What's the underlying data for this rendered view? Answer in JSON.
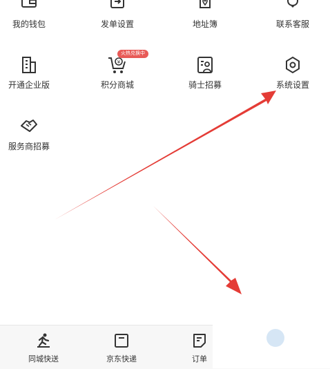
{
  "menu": {
    "items": [
      {
        "label": "我的钱包",
        "icon": "wallet-icon"
      },
      {
        "label": "发单设置",
        "icon": "order-settings-icon"
      },
      {
        "label": "地址簿",
        "icon": "address-book-icon"
      },
      {
        "label": "联系客服",
        "icon": "headset-icon"
      },
      {
        "label": "开通企业版",
        "icon": "building-icon"
      },
      {
        "label": "积分商城",
        "icon": "points-cart-icon"
      },
      {
        "label": "骑士招募",
        "icon": "rider-recruit-icon"
      },
      {
        "label": "系统设置",
        "icon": "settings-icon"
      },
      {
        "label": "服务商招募",
        "icon": "handshake-icon"
      }
    ],
    "badge": "火热兑换中"
  },
  "tabbar": {
    "tabs": [
      {
        "label": "同城快送",
        "icon": "runner-icon"
      },
      {
        "label": "京东快递",
        "icon": "box-icon"
      },
      {
        "label": "订单",
        "icon": "order-icon"
      }
    ]
  },
  "colors": {
    "annotation_arrow": "#e3322b",
    "badge": "#e85a57",
    "text": "#333333",
    "icon_stroke": "#333333"
  }
}
